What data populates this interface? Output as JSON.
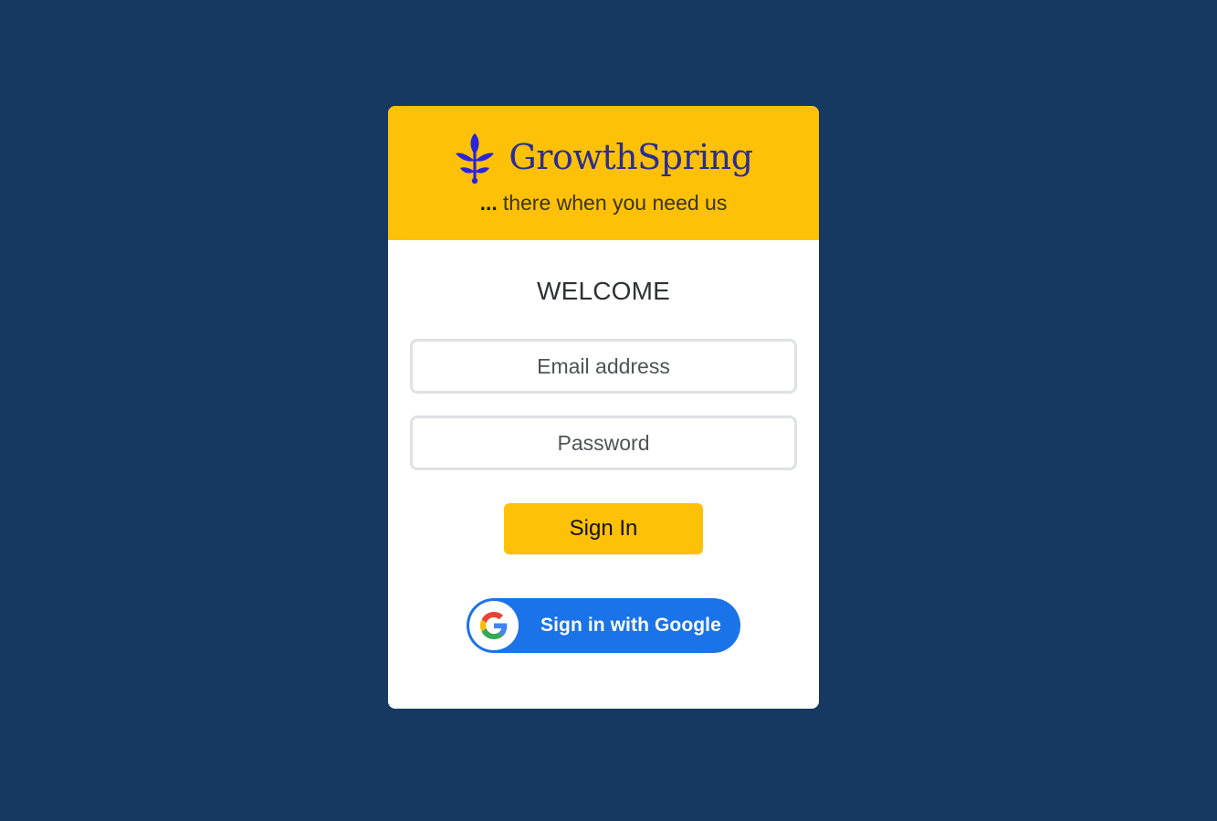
{
  "brand": {
    "name": "GrowthSpring",
    "tagline_prefix": "...",
    "tagline": "there when you need us",
    "logo_icon": "sprout-icon",
    "logo_color": "#2b2e91"
  },
  "colors": {
    "background": "#163961",
    "accent": "#ffc107",
    "google_button": "#1a73e8"
  },
  "form": {
    "title": "WELCOME",
    "email_placeholder": "Email address",
    "password_placeholder": "Password",
    "sign_in_label": "Sign In",
    "google_label": "Sign in with Google",
    "google_icon": "google-g-icon"
  }
}
